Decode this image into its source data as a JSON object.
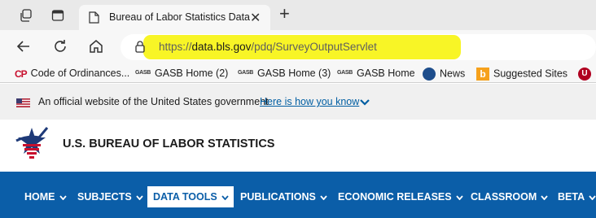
{
  "browser": {
    "tab": {
      "title": "Bureau of Labor Statistics Data"
    },
    "url": {
      "proto": "https://",
      "host": "data.bls.gov",
      "path": "/pdq/SurveyOutputServlet"
    },
    "highlight_color": "#f8f526",
    "favorites": [
      {
        "label": "Code of Ordinances...",
        "icon": "cp-icon"
      },
      {
        "label": "GASB Home (2)",
        "icon": "gasb-icon"
      },
      {
        "label": "GASB Home (3)",
        "icon": "gasb-icon"
      },
      {
        "label": "GASB Home",
        "icon": "gasb-icon"
      },
      {
        "label": "News",
        "icon": "news-icon"
      },
      {
        "label": "Suggested Sites",
        "icon": "bing-icon"
      },
      {
        "label": "",
        "icon": "red-circle-icon"
      }
    ]
  },
  "gov_banner": {
    "text": "An official website of the United States government",
    "link": "Here is how you know"
  },
  "site": {
    "name": "U.S. BUREAU OF LABOR STATISTICS",
    "brand_color": "#0b5ea8",
    "nav": [
      {
        "label": "HOME",
        "active": false
      },
      {
        "label": "SUBJECTS",
        "active": false
      },
      {
        "label": "DATA TOOLS",
        "active": true
      },
      {
        "label": "PUBLICATIONS",
        "active": false
      },
      {
        "label": "ECONOMIC RELEASES",
        "active": false
      },
      {
        "label": "CLASSROOM",
        "active": false
      },
      {
        "label": "BETA",
        "active": false
      }
    ]
  }
}
